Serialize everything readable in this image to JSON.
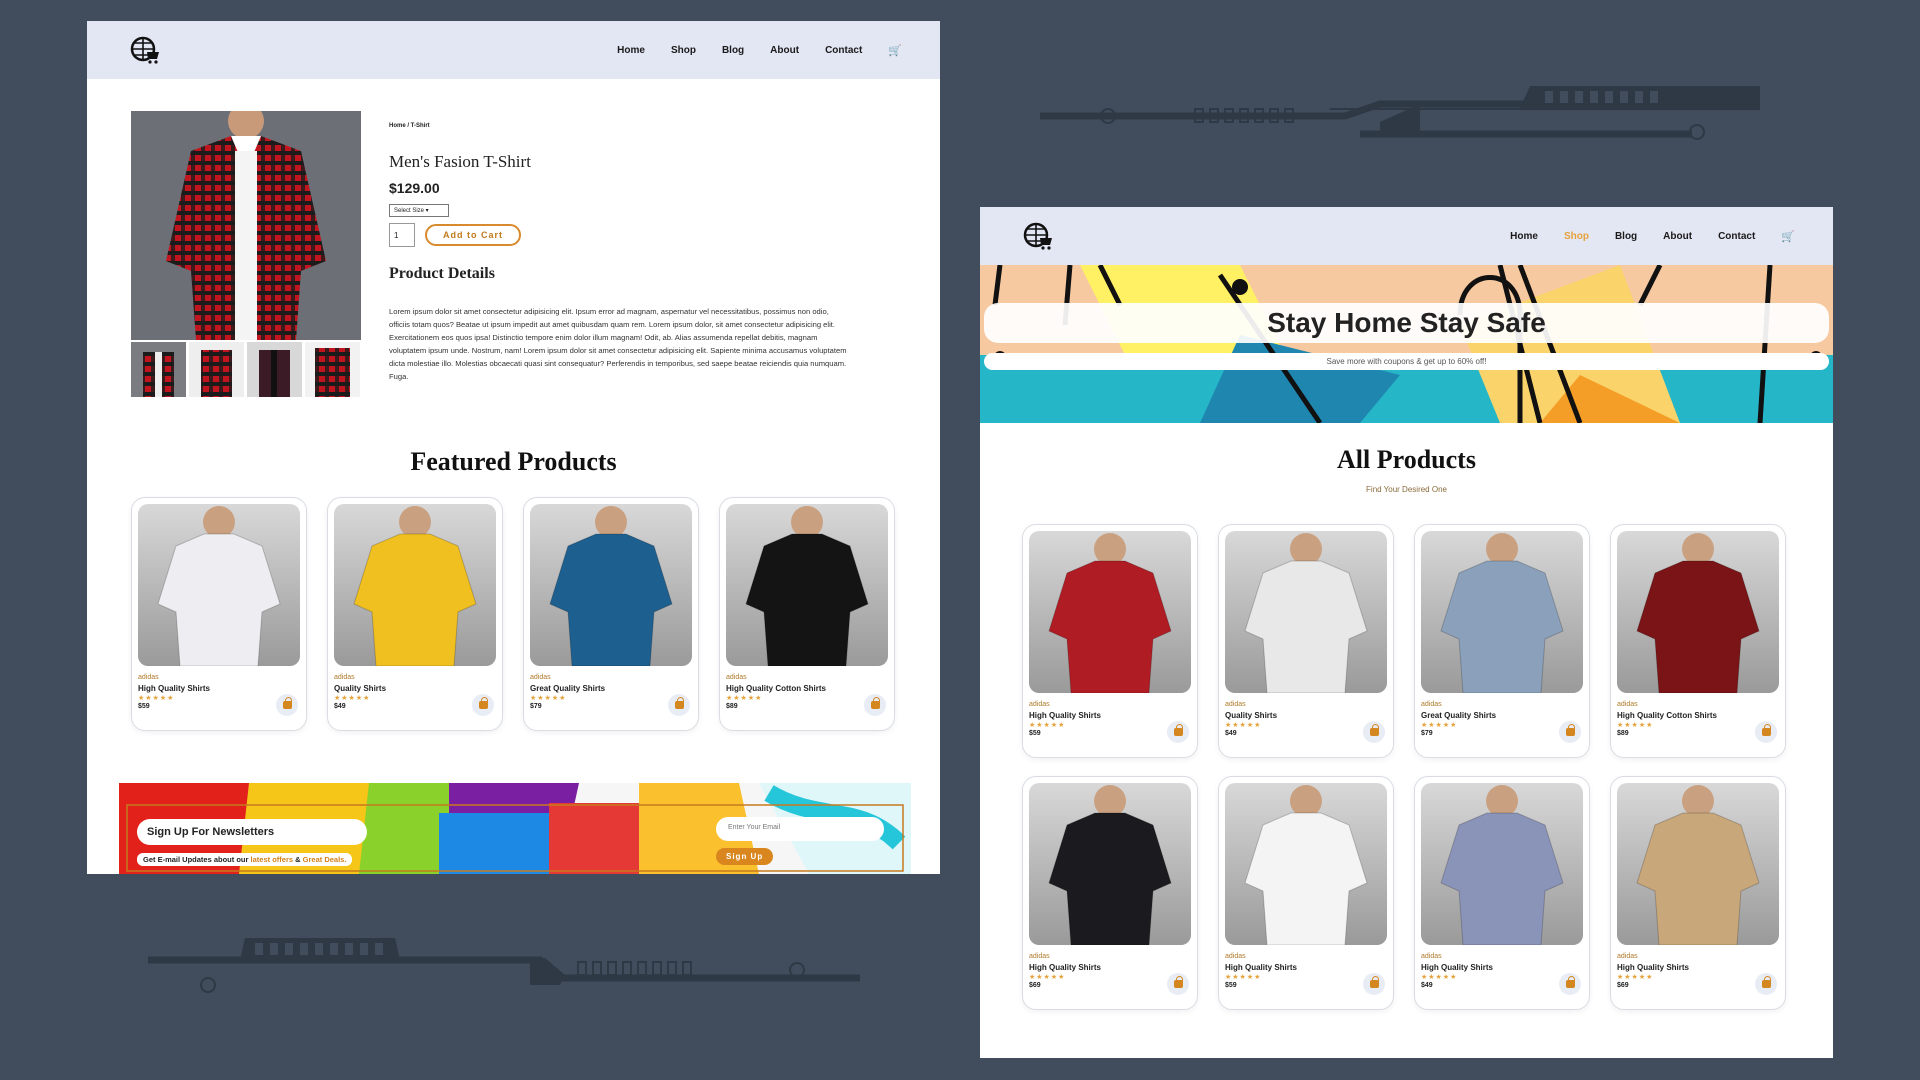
{
  "logo": "globe-cart-logo",
  "colors": {
    "background": "#414d5c",
    "nav": "#e3e6f3",
    "accent": "#e6a23c",
    "button": "#d9861f"
  },
  "page1": {
    "nav": [
      "Home",
      "Shop",
      "Blog",
      "About",
      "Contact"
    ],
    "breadcrumb": "Home / T-Shirt",
    "product_title": "Men's Fasion T-Shirt",
    "price": "$129.00",
    "size_select": "Select Size",
    "qty": "1",
    "add_to_cart": "Add to Cart",
    "details_heading": "Product Details",
    "description": "Lorem ipsum dolor sit amet consectetur adipisicing elit. Ipsum error ad magnam, aspernatur vel necessitatibus, possimus non odio, officiis totam quos? Beatae ut ipsum impedit aut amet quibusdam quam rem. Lorem ipsum dolor, sit amet consectetur adipisicing elit. Exercitationem eos quos ipsa! Distinctio tempore enim dolor illum magnam! Odit, ab. Alias assumenda repellat debitis, magnam voluptatem ipsum unde. Nostrum, nam! Lorem ipsum dolor sit amet consectetur adipisicing elit. Sapiente minima accusamus voluptatem dicta molestiae illo. Molestias obcaecati quasi sint consequatur? Perferendis in temporibus, sed saepe beatae reiciendis quia numquam. Fuga.",
    "featured_title": "Featured Products",
    "featured": [
      {
        "brand": "adidas",
        "name": "High Quality Shirts",
        "price": "$59",
        "color": "#eeeef2"
      },
      {
        "brand": "adidas",
        "name": "Quality Shirts",
        "price": "$49",
        "color": "#f0c020"
      },
      {
        "brand": "adidas",
        "name": "Great Quality Shirts",
        "price": "$79",
        "color": "#1d5f8f"
      },
      {
        "brand": "adidas",
        "name": "High Quality Cotton Shirts",
        "price": "$89",
        "color": "#141414"
      }
    ],
    "newsletter": {
      "title": "Sign Up For Newsletters",
      "subtitle_a": "Get E-mail Updates about our",
      "subtitle_b": "latest offers",
      "subtitle_c": "&",
      "subtitle_d": "Great Deals.",
      "email_placeholder": "Enter Your Email",
      "signup": "Sign Up"
    }
  },
  "page2": {
    "nav": [
      "Home",
      "Shop",
      "Blog",
      "About",
      "Contact"
    ],
    "active": "Shop",
    "hero_title": "Stay Home Stay Safe",
    "hero_sub": "Save more with coupons & get up to 60% off!",
    "section_title": "All Products",
    "section_sub": "Find Your Desired One",
    "products": [
      {
        "brand": "adidas",
        "name": "High Quality Shirts",
        "price": "$59",
        "color": "#b01c24"
      },
      {
        "brand": "adidas",
        "name": "Quality Shirts",
        "price": "$49",
        "color": "#e8e8e8"
      },
      {
        "brand": "adidas",
        "name": "Great Quality Shirts",
        "price": "$79",
        "color": "#8aa0bb"
      },
      {
        "brand": "adidas",
        "name": "High Quality Cotton Shirts",
        "price": "$89",
        "color": "#7a1416"
      },
      {
        "brand": "adidas",
        "name": "High Quality Shirts",
        "price": "$69",
        "color": "#1b1b1f"
      },
      {
        "brand": "adidas",
        "name": "High Quality Shirts",
        "price": "$59",
        "color": "#f4f4f4"
      },
      {
        "brand": "adidas",
        "name": "High Quality Shirts",
        "price": "$49",
        "color": "#8a93b8"
      },
      {
        "brand": "adidas",
        "name": "High Quality Shirts",
        "price": "$69",
        "color": "#c8a77a"
      }
    ]
  }
}
